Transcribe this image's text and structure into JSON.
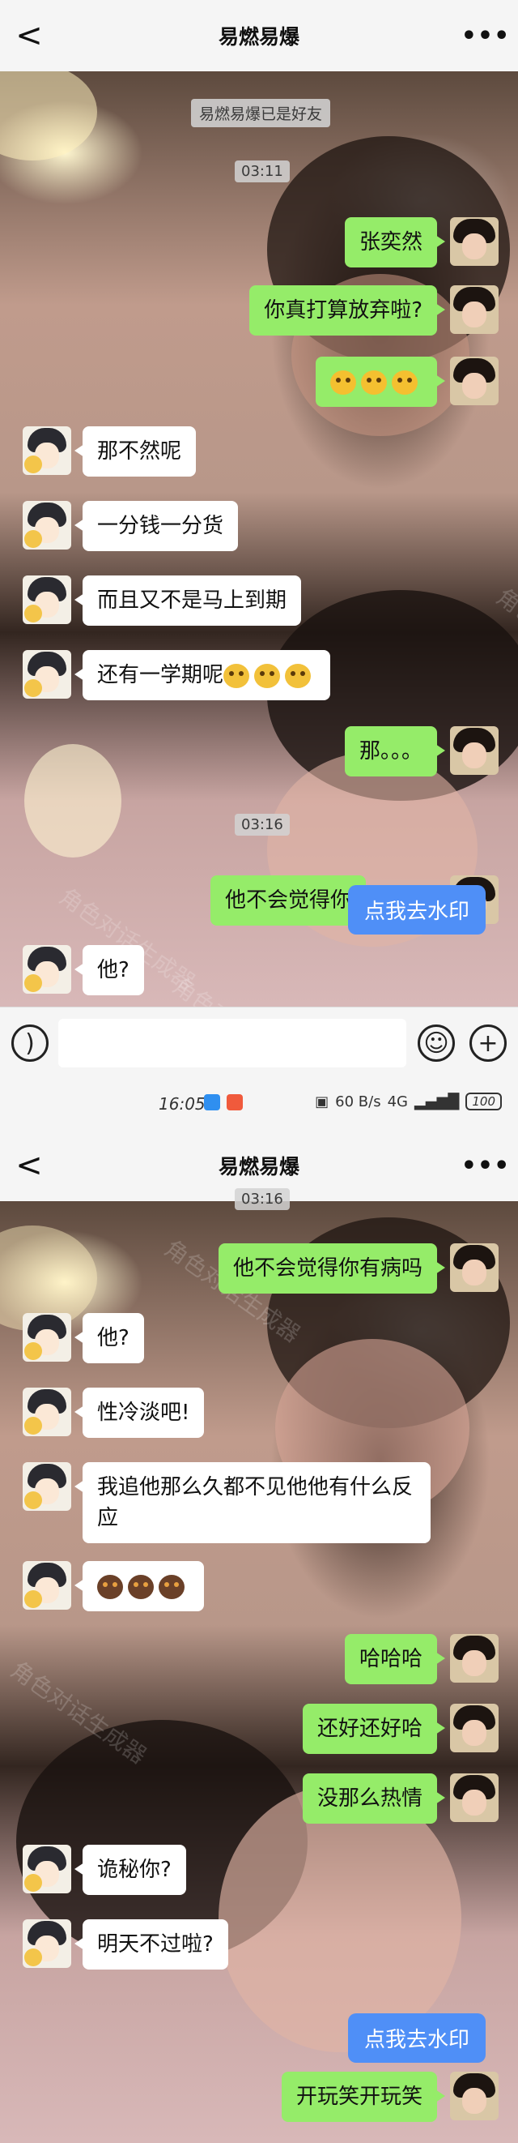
{
  "screen1": {
    "header": {
      "back": "<",
      "title": "易燃易爆",
      "more": "•••"
    },
    "system_tip": "易燃易爆已是好友",
    "time1": "03:11",
    "time2": "03:16",
    "messages": [
      {
        "text": "张奕然"
      },
      {
        "text": "你真打算放弃啦?"
      },
      {
        "text": ""
      },
      {
        "text": "那不然呢"
      },
      {
        "text": "一分钱一分货"
      },
      {
        "text": "而且又不是马上到期"
      },
      {
        "text": "还有一学期呢"
      },
      {
        "text": "那。。。"
      },
      {
        "text": "他不会觉得你"
      },
      {
        "text": "他?"
      }
    ],
    "watermark_button": "点我去水印"
  },
  "status_bar": {
    "time": "16:05",
    "network": "60 B/s",
    "signal": "4G",
    "battery": "100"
  },
  "screen2": {
    "header": {
      "back": "<",
      "title": "易燃易爆",
      "more": "•••"
    },
    "time": "03:16",
    "messages": [
      {
        "text": "他不会觉得你有病吗"
      },
      {
        "text": "他?"
      },
      {
        "text": "性冷淡吧!"
      },
      {
        "text": "我追他那么久都不见他他有什么反应"
      },
      {
        "text": ""
      },
      {
        "text": "哈哈哈"
      },
      {
        "text": "还好还好哈"
      },
      {
        "text": "没那么热情"
      },
      {
        "text": "诡秘你?"
      },
      {
        "text": "明天不过啦?"
      },
      {
        "text": "开玩笑开玩笑"
      }
    ],
    "watermark_button": "点我去水印"
  },
  "watermark_text": "角色对话生成器",
  "icons": [
    "back-icon",
    "more-icon",
    "voice-icon",
    "emoji-icon",
    "plus-icon"
  ],
  "colors": {
    "my_bubble": "#95ec69",
    "their_bubble": "#ffffff",
    "watermark_button": "#4f8ff7"
  }
}
